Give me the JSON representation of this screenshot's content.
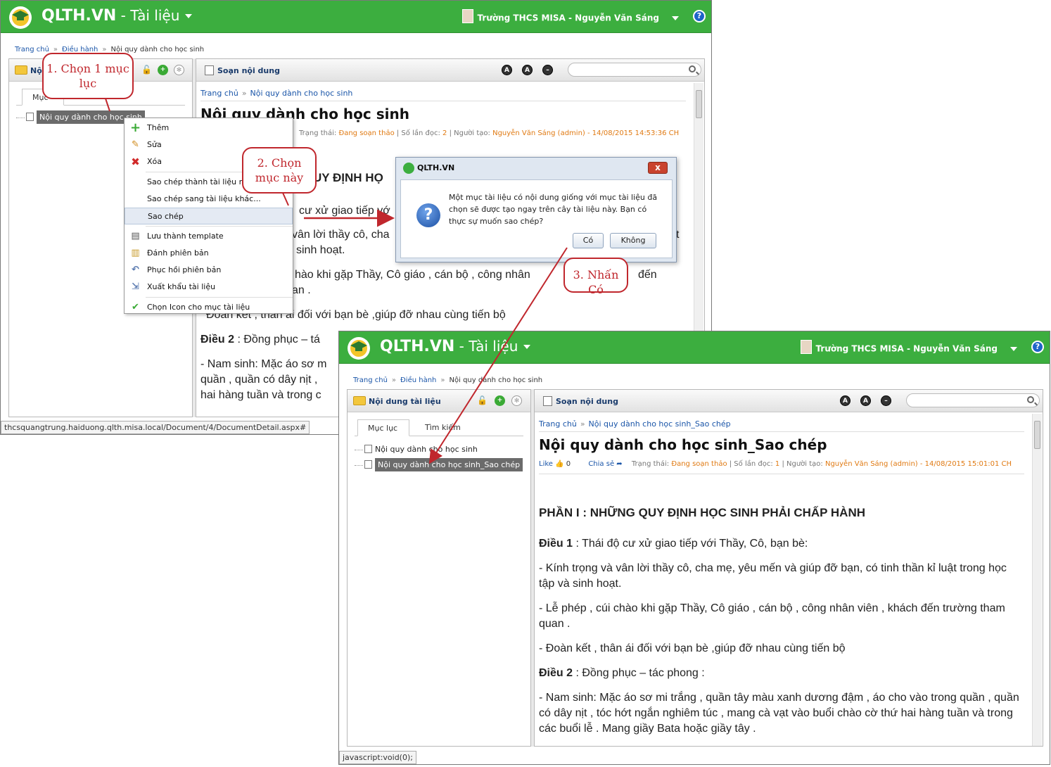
{
  "app": {
    "brand": "QLTH.VN",
    "module": " - Tài liệu",
    "user": "Trường THCS MISA - Nguyễn Văn Sáng",
    "help": "?"
  },
  "breadcrumb": {
    "home": "Trang chủ",
    "section": "Điều hành",
    "current": "Nội quy dành cho học sinh"
  },
  "left_panel": {
    "title": "Nội dung tài liệu",
    "tab_catalog": "Mục lục",
    "tab_search": "Tìm kiếm"
  },
  "editor": {
    "title": "Soạn nội dung",
    "font_up": "A",
    "font_down": "A",
    "minus": "–"
  },
  "windowA": {
    "left_title_partial": "Nộ",
    "tab_partial": "Mục",
    "tree_item": "Nội quy dành cho học sinh",
    "doc_breadcrumb": {
      "home": "Trang chủ",
      "current": "Nội quy dành cho học sinh"
    },
    "doc_title": "Nội quy dành cho học sinh",
    "meta": {
      "status_label": "Trạng thái:",
      "status": "Đang soạn thảo",
      "reads_label": "| Số lần đọc:",
      "reads": "2",
      "creator_label": "| Người tạo:",
      "creator": "Nguyễn Văn Sáng (admin) - 14/08/2015 14:53:36 CH"
    },
    "body": {
      "heading_partial": "UY ĐỊNH HỌ",
      "line1": "cư xử giao tiếp vớ",
      "line2": "vân lời thầy cô, cha",
      "line2_end": "t",
      "line3": "sinh hoạt.",
      "line4": "hào khi gặp Thầy, Cô giáo , cán bộ , công nhân",
      "line4_end": "đến",
      "line5": "an .",
      "line6": "Đoàn kết , thân ái đối với bạn bè ,giúp đỡ nhau cùng tiến bộ",
      "line7_label": "Điều 2",
      "line7": " : Đồng phục – tá",
      "line8": "- Nam sinh:  Mặc áo sơ m",
      "line9": "quần , quần có dây nịt ,",
      "line10": "hai hàng tuần và trong c"
    },
    "status_url": "thcsquangtrung.haiduong.qlth.misa.local/Document/4/DocumentDetail.aspx#"
  },
  "context_menu": {
    "items": [
      {
        "label": "Thêm",
        "icon": "plus-icon"
      },
      {
        "label": "Sửa",
        "icon": "pencil-icon"
      },
      {
        "label": "Xóa",
        "icon": "delete-icon"
      },
      {
        "label": "Sao chép thành tài liệu m",
        "icon": ""
      },
      {
        "label": "Sao chép sang tài liệu khác...",
        "icon": ""
      },
      {
        "label": "Sao chép",
        "icon": ""
      },
      {
        "label": "Lưu thành template",
        "icon": "template-icon"
      },
      {
        "label": "Đánh phiên bản",
        "icon": "version-icon"
      },
      {
        "label": "Phục hồi phiên bản",
        "icon": "restore-icon"
      },
      {
        "label": "Xuất khẩu tài liệu",
        "icon": "export-icon"
      },
      {
        "label": "Chọn Icon cho mục tài liệu",
        "icon": "check-icon"
      }
    ]
  },
  "dialog": {
    "title": "QLTH.VN",
    "close": "x",
    "message": "Một mục tài liệu có nội dung giống với mục tài liệu đã chọn sẽ được tạo ngay trên cây tài liệu này. Bạn có thực sự muốn sao chép?",
    "yes": "Có",
    "no": "Không"
  },
  "callouts": {
    "step1": "1. Chọn 1 mục lục",
    "step2": "2. Chọn mục này",
    "step3": "3. Nhấn Có"
  },
  "windowB": {
    "tree_items": [
      "Nội quy dành cho học sinh",
      "Nội quy dành cho học sinh_Sao chép"
    ],
    "doc_breadcrumb": {
      "home": "Trang chủ",
      "current": "Nội quy dành cho học sinh_Sao chép"
    },
    "doc_title": "Nội quy dành cho học sinh_Sao chép",
    "like": "Like",
    "like_count": "0",
    "share": "Chia sẻ",
    "meta": {
      "status_label": "Trạng thái:",
      "status": "Đang soạn thảo",
      "reads_label": "| Số lần đọc:",
      "reads": "1",
      "creator_label": "| Người tạo:",
      "creator": "Nguyễn Văn Sáng (admin) - 14/08/2015 15:01:01 CH"
    },
    "body": {
      "heading": "PHẦN I : NHỮNG QUY ĐỊNH HỌC SINH PHẢI CHẤP HÀNH",
      "d1_label": "Điều 1",
      "d1": " : Thái độ cư xử giao tiếp với Thầy, Cô, bạn bè:",
      "p1": "- Kính trọng và vân lời thầy cô, cha mẹ, yêu mến và giúp đỡ bạn, có tinh thần kỉ luật trong học tập và sinh hoạt.",
      "p2": "- Lễ phép , cúi chào khi gặp Thầy, Cô giáo , cán bộ , công nhân viên , khách đến trường tham quan .",
      "p3": "- Đoàn kết , thân ái đối với bạn bè ,giúp đỡ nhau cùng tiến bộ",
      "d2_label": "Điều 2",
      "d2": " : Đồng phục – tác phong :",
      "p4": "- Nam sinh:  Mặc áo sơ mi trắng , quần tây màu xanh dương đậm , áo cho vào trong quần , quần có dây nịt , tóc hớt ngắn nghiêm túc , mang cà vạt vào buổi chào cờ thứ hai hàng tuần và trong các buổi lễ . Mang giầy Bata hoặc giầy tây ."
    },
    "status_url": "javascript:void(0);"
  },
  "colors": {
    "brand_green": "#3cae3f",
    "callout_red": "#c0272d",
    "meta_orange": "#e07a13",
    "link_blue": "#1a55a8"
  }
}
